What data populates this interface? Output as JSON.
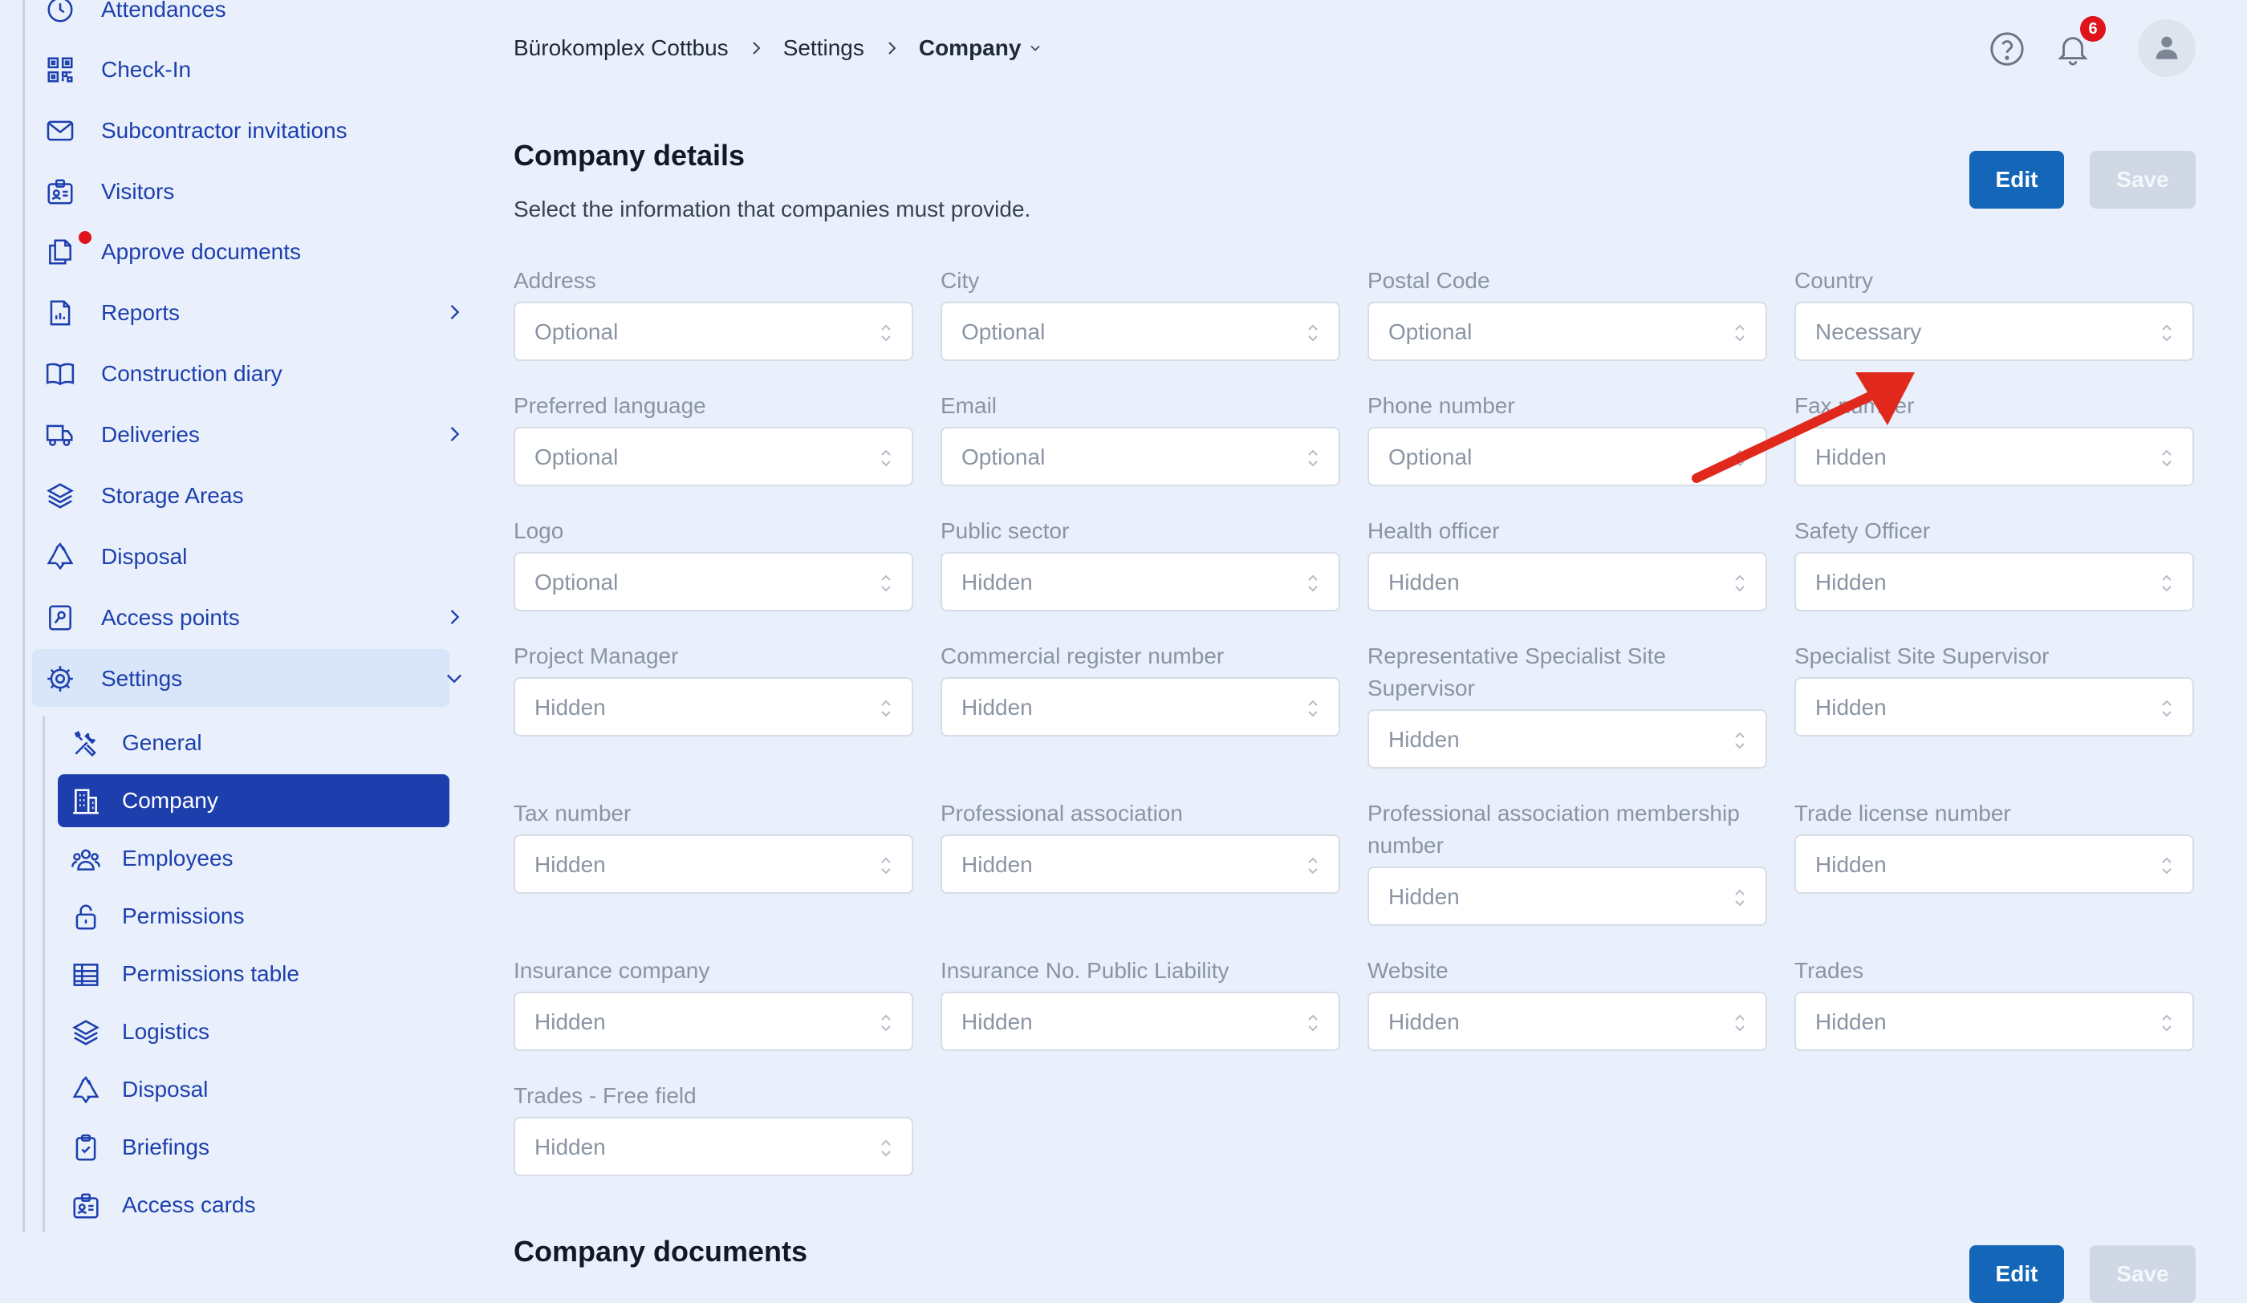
{
  "sidebar": {
    "items": [
      {
        "label": "Attendances",
        "icon": "clock-icon"
      },
      {
        "label": "Check-In",
        "icon": "qr-code-icon"
      },
      {
        "label": "Subcontractor invitations",
        "icon": "envelope-icon"
      },
      {
        "label": "Visitors",
        "icon": "badge-icon"
      },
      {
        "label": "Approve documents",
        "icon": "documents-icon"
      },
      {
        "label": "Reports",
        "icon": "report-icon"
      },
      {
        "label": "Construction diary",
        "icon": "book-icon"
      },
      {
        "label": "Deliveries",
        "icon": "truck-icon"
      },
      {
        "label": "Storage Areas",
        "icon": "layers-icon"
      },
      {
        "label": "Disposal",
        "icon": "recycle-icon"
      },
      {
        "label": "Access points",
        "icon": "key-card-icon"
      },
      {
        "label": "Settings",
        "icon": "gear-icon"
      }
    ],
    "sub_items": [
      {
        "label": "General",
        "icon": "tools-icon"
      },
      {
        "label": "Company",
        "icon": "building-icon"
      },
      {
        "label": "Employees",
        "icon": "users-icon"
      },
      {
        "label": "Permissions",
        "icon": "unlock-icon"
      },
      {
        "label": "Permissions table",
        "icon": "table-icon"
      },
      {
        "label": "Logistics",
        "icon": "layers-icon"
      },
      {
        "label": "Disposal",
        "icon": "recycle-icon"
      },
      {
        "label": "Briefings",
        "icon": "clipboard-icon"
      },
      {
        "label": "Access cards",
        "icon": "badge-icon"
      }
    ]
  },
  "header": {
    "breadcrumb": [
      "Bürokomplex Cottbus",
      "Settings",
      "Company"
    ],
    "notification_count": "6"
  },
  "company_details": {
    "title": "Company details",
    "description": "Select the information that companies must provide.",
    "edit_label": "Edit",
    "save_label": "Save",
    "fields": [
      {
        "label": "Address",
        "value": "Optional"
      },
      {
        "label": "City",
        "value": "Optional"
      },
      {
        "label": "Postal Code",
        "value": "Optional"
      },
      {
        "label": "Country",
        "value": "Necessary"
      },
      {
        "label": "Preferred language",
        "value": "Optional"
      },
      {
        "label": "Email",
        "value": "Optional"
      },
      {
        "label": "Phone number",
        "value": "Optional"
      },
      {
        "label": "Fax number",
        "value": "Hidden"
      },
      {
        "label": "Logo",
        "value": "Optional"
      },
      {
        "label": "Public sector",
        "value": "Hidden"
      },
      {
        "label": "Health officer",
        "value": "Hidden"
      },
      {
        "label": "Safety Officer",
        "value": "Hidden"
      },
      {
        "label": "Project Manager",
        "value": "Hidden"
      },
      {
        "label": "Commercial register number",
        "value": "Hidden"
      },
      {
        "label": "Representative Specialist Site Supervisor",
        "value": "Hidden"
      },
      {
        "label": "Specialist Site Supervisor",
        "value": "Hidden"
      },
      {
        "label": "Tax number",
        "value": "Hidden"
      },
      {
        "label": "Professional association",
        "value": "Hidden"
      },
      {
        "label": "Professional association membership number",
        "value": "Hidden"
      },
      {
        "label": "Trade license number",
        "value": "Hidden"
      },
      {
        "label": "Insurance company",
        "value": "Hidden"
      },
      {
        "label": "Insurance No. Public Liability",
        "value": "Hidden"
      },
      {
        "label": "Website",
        "value": "Hidden"
      },
      {
        "label": "Trades",
        "value": "Hidden"
      },
      {
        "label": "Trades - Free field",
        "value": "Hidden"
      }
    ]
  },
  "company_documents": {
    "title": "Company documents",
    "edit_label": "Edit",
    "save_label": "Save"
  },
  "colors": {
    "accent": "#1d3fae",
    "primary_button": "#1467b8",
    "annotation_arrow": "#e0291c",
    "background": "#e9f0fb"
  }
}
